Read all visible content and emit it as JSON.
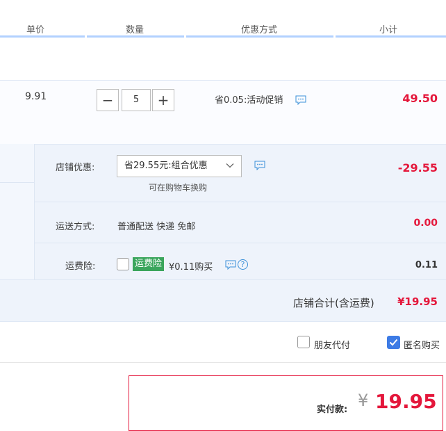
{
  "header": {
    "col_price": "单价",
    "col_qty": "数量",
    "col_promo": "优惠方式",
    "col_subtotal": "小计"
  },
  "item": {
    "price": "9.91",
    "qty_minus": "−",
    "qty_value": "5",
    "qty_plus": "+",
    "promo_text": "省0.05:活动促销",
    "subtotal": "49.50"
  },
  "shop": {
    "discount_label": "店铺优惠:",
    "discount_select": "省29.55元:组合优惠",
    "discount_hint": "可在购物车换购",
    "discount_value": "-29.55",
    "shipping_label": "运送方式:",
    "shipping_text": "普通配送 快递 免邮",
    "shipping_value": "0.00",
    "insurance_label": "运费险:",
    "insurance_badge": "运费险",
    "insurance_price": "¥0.11购买",
    "insurance_help": "?",
    "insurance_value": "0.11",
    "total_label": "店铺合计(含运费)",
    "total_value": "¥19.95"
  },
  "options": {
    "friend_pay": "朋友代付",
    "anonymous": "匿名购买",
    "anonymous_checked": true
  },
  "payment": {
    "label": "实付款:",
    "currency": "¥",
    "amount": "19.95"
  },
  "icons": {
    "message": "message-icon",
    "help": "help-circle-icon",
    "chevron": "chevron-down-icon",
    "check": "checkmark-icon"
  },
  "colors": {
    "accent_red": "#e4173b",
    "header_line": "#b2d1ff",
    "section_bg": "#eef3fb",
    "badge_green": "#3aa55c",
    "check_blue": "#3d7be5",
    "icon_blue": "#3a8fd8"
  }
}
